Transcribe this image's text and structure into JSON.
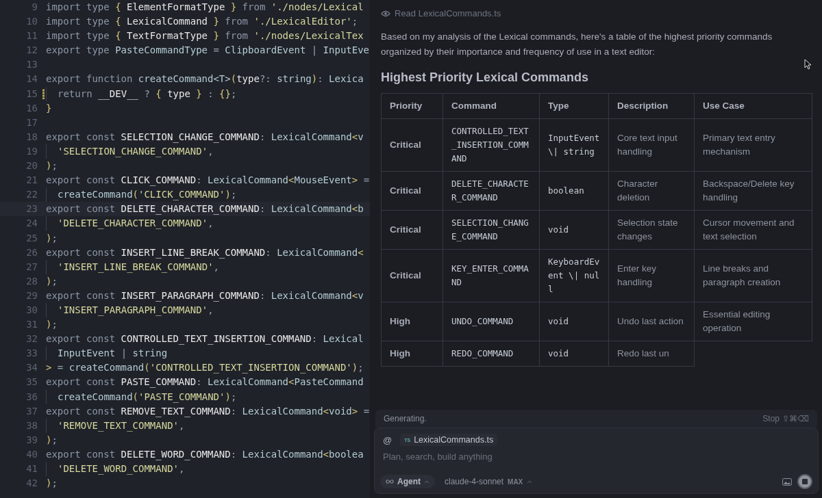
{
  "editor": {
    "lines": [
      {
        "number": "9",
        "tokens": [
          {
            "kind": "kw",
            "text": "import type "
          },
          {
            "kind": "br",
            "text": "{ "
          },
          {
            "kind": "id",
            "text": "ElementFormatType "
          },
          {
            "kind": "br",
            "text": "} "
          },
          {
            "kind": "kw",
            "text": "from "
          },
          {
            "kind": "str",
            "text": "'./nodes/Lexical"
          }
        ]
      },
      {
        "number": "10",
        "tokens": [
          {
            "kind": "kw",
            "text": "import type "
          },
          {
            "kind": "br",
            "text": "{ "
          },
          {
            "kind": "id",
            "text": "LexicalCommand "
          },
          {
            "kind": "br",
            "text": "} "
          },
          {
            "kind": "kw",
            "text": "from "
          },
          {
            "kind": "str",
            "text": "'./LexicalEditor'"
          },
          {
            "kind": "pn",
            "text": ";"
          }
        ]
      },
      {
        "number": "11",
        "tokens": [
          {
            "kind": "kw",
            "text": "import type "
          },
          {
            "kind": "br",
            "text": "{ "
          },
          {
            "kind": "id",
            "text": "TextFormatType "
          },
          {
            "kind": "br",
            "text": "} "
          },
          {
            "kind": "kw",
            "text": "from "
          },
          {
            "kind": "str",
            "text": "'./nodes/LexicalTex"
          }
        ]
      },
      {
        "number": "12",
        "tokens": [
          {
            "kind": "kw",
            "text": "export type "
          },
          {
            "kind": "ty",
            "text": "PasteCommandType "
          },
          {
            "kind": "pn",
            "text": "= "
          },
          {
            "kind": "ty",
            "text": "ClipboardEvent "
          },
          {
            "kind": "pn",
            "text": "| "
          },
          {
            "kind": "ty",
            "text": "InputEve"
          }
        ]
      },
      {
        "number": "13"
      },
      {
        "number": "14",
        "tokens": [
          {
            "kind": "kw",
            "text": "export function "
          },
          {
            "kind": "fn",
            "text": "createCommand"
          },
          {
            "kind": "ty",
            "text": "<T>"
          },
          {
            "kind": "br",
            "text": "("
          },
          {
            "kind": "id",
            "text": "type"
          },
          {
            "kind": "pn",
            "text": "?: "
          },
          {
            "kind": "ty",
            "text": "string"
          },
          {
            "kind": "br",
            "text": ")"
          },
          {
            "kind": "pn",
            "text": ": "
          },
          {
            "kind": "ty",
            "text": "Lexica"
          }
        ]
      },
      {
        "number": "15",
        "modified": true,
        "indent": true,
        "tokens": [
          {
            "kind": "kw",
            "text": "return "
          },
          {
            "kind": "id",
            "text": "__DEV__ "
          },
          {
            "kind": "pn",
            "text": "? "
          },
          {
            "kind": "br",
            "text": "{ "
          },
          {
            "kind": "id",
            "text": "type "
          },
          {
            "kind": "br",
            "text": "} "
          },
          {
            "kind": "pn",
            "text": ": "
          },
          {
            "kind": "br",
            "text": "{}"
          },
          {
            "kind": "pn",
            "text": ";"
          }
        ]
      },
      {
        "number": "16",
        "tokens": [
          {
            "kind": "br",
            "text": "}"
          }
        ]
      },
      {
        "number": "17"
      },
      {
        "number": "18",
        "tokens": [
          {
            "kind": "kw",
            "text": "export const "
          },
          {
            "kind": "id",
            "text": "SELECTION_CHANGE_COMMAND"
          },
          {
            "kind": "pn",
            "text": ": "
          },
          {
            "kind": "ty",
            "text": "LexicalCommand"
          },
          {
            "kind": "br",
            "text": "<"
          },
          {
            "kind": "ty",
            "text": "v"
          }
        ]
      },
      {
        "number": "19",
        "indent": true,
        "tokens": [
          {
            "kind": "str",
            "text": "'SELECTION_CHANGE_COMMAND'"
          },
          {
            "kind": "pn",
            "text": ","
          }
        ]
      },
      {
        "number": "20",
        "tokens": [
          {
            "kind": "br",
            "text": ")"
          },
          {
            "kind": "pn",
            "text": ";"
          }
        ]
      },
      {
        "number": "21",
        "tokens": [
          {
            "kind": "kw",
            "text": "export const "
          },
          {
            "kind": "id",
            "text": "CLICK_COMMAND"
          },
          {
            "kind": "pn",
            "text": ": "
          },
          {
            "kind": "ty",
            "text": "LexicalCommand"
          },
          {
            "kind": "br",
            "text": "<"
          },
          {
            "kind": "ty",
            "text": "MouseEvent"
          },
          {
            "kind": "br",
            "text": "> "
          },
          {
            "kind": "pn",
            "text": "="
          }
        ]
      },
      {
        "number": "22",
        "indent": true,
        "tokens": [
          {
            "kind": "fn",
            "text": "createCommand"
          },
          {
            "kind": "br",
            "text": "("
          },
          {
            "kind": "str",
            "text": "'CLICK_COMMAND'"
          },
          {
            "kind": "br",
            "text": ")"
          },
          {
            "kind": "pn",
            "text": ";"
          }
        ]
      },
      {
        "number": "23",
        "current": true,
        "tokens": [
          {
            "kind": "kw",
            "text": "export const "
          },
          {
            "kind": "id",
            "text": "DELETE_CHARACTER_COMMAND"
          },
          {
            "kind": "pn",
            "text": ": "
          },
          {
            "kind": "ty",
            "text": "LexicalCommand"
          },
          {
            "kind": "br",
            "text": "<"
          },
          {
            "kind": "ty",
            "text": "b"
          }
        ]
      },
      {
        "number": "24",
        "indent": true,
        "tokens": [
          {
            "kind": "str",
            "text": "'DELETE_CHARACTER_COMMAND'"
          },
          {
            "kind": "pn",
            "text": ","
          }
        ]
      },
      {
        "number": "25",
        "tokens": [
          {
            "kind": "br",
            "text": ")"
          },
          {
            "kind": "pn",
            "text": ";"
          }
        ]
      },
      {
        "number": "26",
        "tokens": [
          {
            "kind": "kw",
            "text": "export const "
          },
          {
            "kind": "id",
            "text": "INSERT_LINE_BREAK_COMMAND"
          },
          {
            "kind": "pn",
            "text": ": "
          },
          {
            "kind": "ty",
            "text": "LexicalCommand"
          },
          {
            "kind": "br",
            "text": "<"
          }
        ]
      },
      {
        "number": "27",
        "indent": true,
        "tokens": [
          {
            "kind": "str",
            "text": "'INSERT_LINE_BREAK_COMMAND'"
          },
          {
            "kind": "pn",
            "text": ","
          }
        ]
      },
      {
        "number": "28",
        "tokens": [
          {
            "kind": "br",
            "text": ")"
          },
          {
            "kind": "pn",
            "text": ";"
          }
        ]
      },
      {
        "number": "29",
        "tokens": [
          {
            "kind": "kw",
            "text": "export const "
          },
          {
            "kind": "id",
            "text": "INSERT_PARAGRAPH_COMMAND"
          },
          {
            "kind": "pn",
            "text": ": "
          },
          {
            "kind": "ty",
            "text": "LexicalCommand"
          },
          {
            "kind": "br",
            "text": "<"
          },
          {
            "kind": "ty",
            "text": "v"
          }
        ]
      },
      {
        "number": "30",
        "indent": true,
        "tokens": [
          {
            "kind": "str",
            "text": "'INSERT_PARAGRAPH_COMMAND'"
          },
          {
            "kind": "pn",
            "text": ","
          }
        ]
      },
      {
        "number": "31",
        "tokens": [
          {
            "kind": "br",
            "text": ")"
          },
          {
            "kind": "pn",
            "text": ";"
          }
        ]
      },
      {
        "number": "32",
        "tokens": [
          {
            "kind": "kw",
            "text": "export const "
          },
          {
            "kind": "id",
            "text": "CONTROLLED_TEXT_INSERTION_COMMAND"
          },
          {
            "kind": "pn",
            "text": ": "
          },
          {
            "kind": "ty",
            "text": "Lexical"
          }
        ]
      },
      {
        "number": "33",
        "indent": true,
        "tokens": [
          {
            "kind": "ty",
            "text": "InputEvent "
          },
          {
            "kind": "pn",
            "text": "| "
          },
          {
            "kind": "ty",
            "text": "string"
          }
        ]
      },
      {
        "number": "34",
        "tokens": [
          {
            "kind": "br",
            "text": "> "
          },
          {
            "kind": "pn",
            "text": "= "
          },
          {
            "kind": "fn",
            "text": "createCommand"
          },
          {
            "kind": "br",
            "text": "("
          },
          {
            "kind": "str",
            "text": "'CONTROLLED_TEXT_INSERTION_COMMAND'"
          },
          {
            "kind": "br",
            "text": ")"
          },
          {
            "kind": "pn",
            "text": ";"
          }
        ]
      },
      {
        "number": "35",
        "tokens": [
          {
            "kind": "kw",
            "text": "export const "
          },
          {
            "kind": "id",
            "text": "PASTE_COMMAND"
          },
          {
            "kind": "pn",
            "text": ": "
          },
          {
            "kind": "ty",
            "text": "LexicalCommand"
          },
          {
            "kind": "br",
            "text": "<"
          },
          {
            "kind": "ty",
            "text": "PasteCommand"
          }
        ]
      },
      {
        "number": "36",
        "indent": true,
        "tokens": [
          {
            "kind": "fn",
            "text": "createCommand"
          },
          {
            "kind": "br",
            "text": "("
          },
          {
            "kind": "str",
            "text": "'PASTE_COMMAND'"
          },
          {
            "kind": "br",
            "text": ")"
          },
          {
            "kind": "pn",
            "text": ";"
          }
        ]
      },
      {
        "number": "37",
        "tokens": [
          {
            "kind": "kw",
            "text": "export const "
          },
          {
            "kind": "id",
            "text": "REMOVE_TEXT_COMMAND"
          },
          {
            "kind": "pn",
            "text": ": "
          },
          {
            "kind": "ty",
            "text": "LexicalCommand"
          },
          {
            "kind": "br",
            "text": "<"
          },
          {
            "kind": "ty",
            "text": "void"
          },
          {
            "kind": "br",
            "text": "> "
          },
          {
            "kind": "pn",
            "text": "="
          }
        ]
      },
      {
        "number": "38",
        "indent": true,
        "tokens": [
          {
            "kind": "str",
            "text": "'REMOVE_TEXT_COMMAND'"
          },
          {
            "kind": "pn",
            "text": ","
          }
        ]
      },
      {
        "number": "39",
        "tokens": [
          {
            "kind": "br",
            "text": ")"
          },
          {
            "kind": "pn",
            "text": ";"
          }
        ]
      },
      {
        "number": "40",
        "tokens": [
          {
            "kind": "kw",
            "text": "export const "
          },
          {
            "kind": "id",
            "text": "DELETE_WORD_COMMAND"
          },
          {
            "kind": "pn",
            "text": ": "
          },
          {
            "kind": "ty",
            "text": "LexicalCommand"
          },
          {
            "kind": "br",
            "text": "<"
          },
          {
            "kind": "ty",
            "text": "boolea"
          }
        ]
      },
      {
        "number": "41",
        "indent": true,
        "tokens": [
          {
            "kind": "str",
            "text": "'DELETE_WORD_COMMAND'"
          },
          {
            "kind": "pn",
            "text": ","
          }
        ]
      },
      {
        "number": "42",
        "tokens": [
          {
            "kind": "br",
            "text": ")"
          },
          {
            "kind": "pn",
            "text": ";"
          }
        ]
      }
    ]
  },
  "chat": {
    "tool_call": "Read LexicalCommands.ts",
    "intro": "Based on my analysis of the Lexical commands, here's a table of the highest priority commands organized by their importance and frequency of use in a text editor:",
    "heading": "Highest Priority Lexical Commands",
    "table": {
      "columns": [
        {
          "label": "Priority",
          "kind": "text"
        },
        {
          "label": "Command",
          "kind": "code"
        },
        {
          "label": "Type",
          "kind": "code"
        },
        {
          "label": "Description",
          "kind": "text"
        },
        {
          "label": "Use Case",
          "kind": "text"
        }
      ],
      "rows": [
        [
          "Critical",
          "CONTROLLED_TEXT_INSERTION_COMMAND",
          "InputEvent \\| string",
          "Core text input handling",
          "Primary text entry mechanism"
        ],
        [
          "Critical",
          "DELETE_CHARACTER_COMMAND",
          "boolean",
          "Character deletion",
          "Backspace/Delete key handling"
        ],
        [
          "Critical",
          "SELECTION_CHANGE_COMMAND",
          "void",
          "Selection state changes",
          "Cursor movement and text selection"
        ],
        [
          "Critical",
          "KEY_ENTER_COMMAND",
          "KeyboardEvent \\| null",
          "Enter key handling",
          "Line breaks and paragraph creation"
        ],
        [
          "High",
          "UNDO_COMMAND",
          "void",
          "Undo last action",
          "Essential editing operation"
        ],
        [
          "High",
          "REDO_COMMAND",
          "void",
          "Redo last un"
        ]
      ]
    }
  },
  "composer": {
    "status": "Generating.",
    "stop": "Stop",
    "stop_shortcut": "⇧⌘⌫",
    "mention": "@",
    "file_badge": "TS",
    "file": "LexicalCommands.ts",
    "placeholder": "Plan, search, build anything",
    "mode": "Agent",
    "model": "claude-4-sonnet",
    "model_badge": "MAX"
  }
}
